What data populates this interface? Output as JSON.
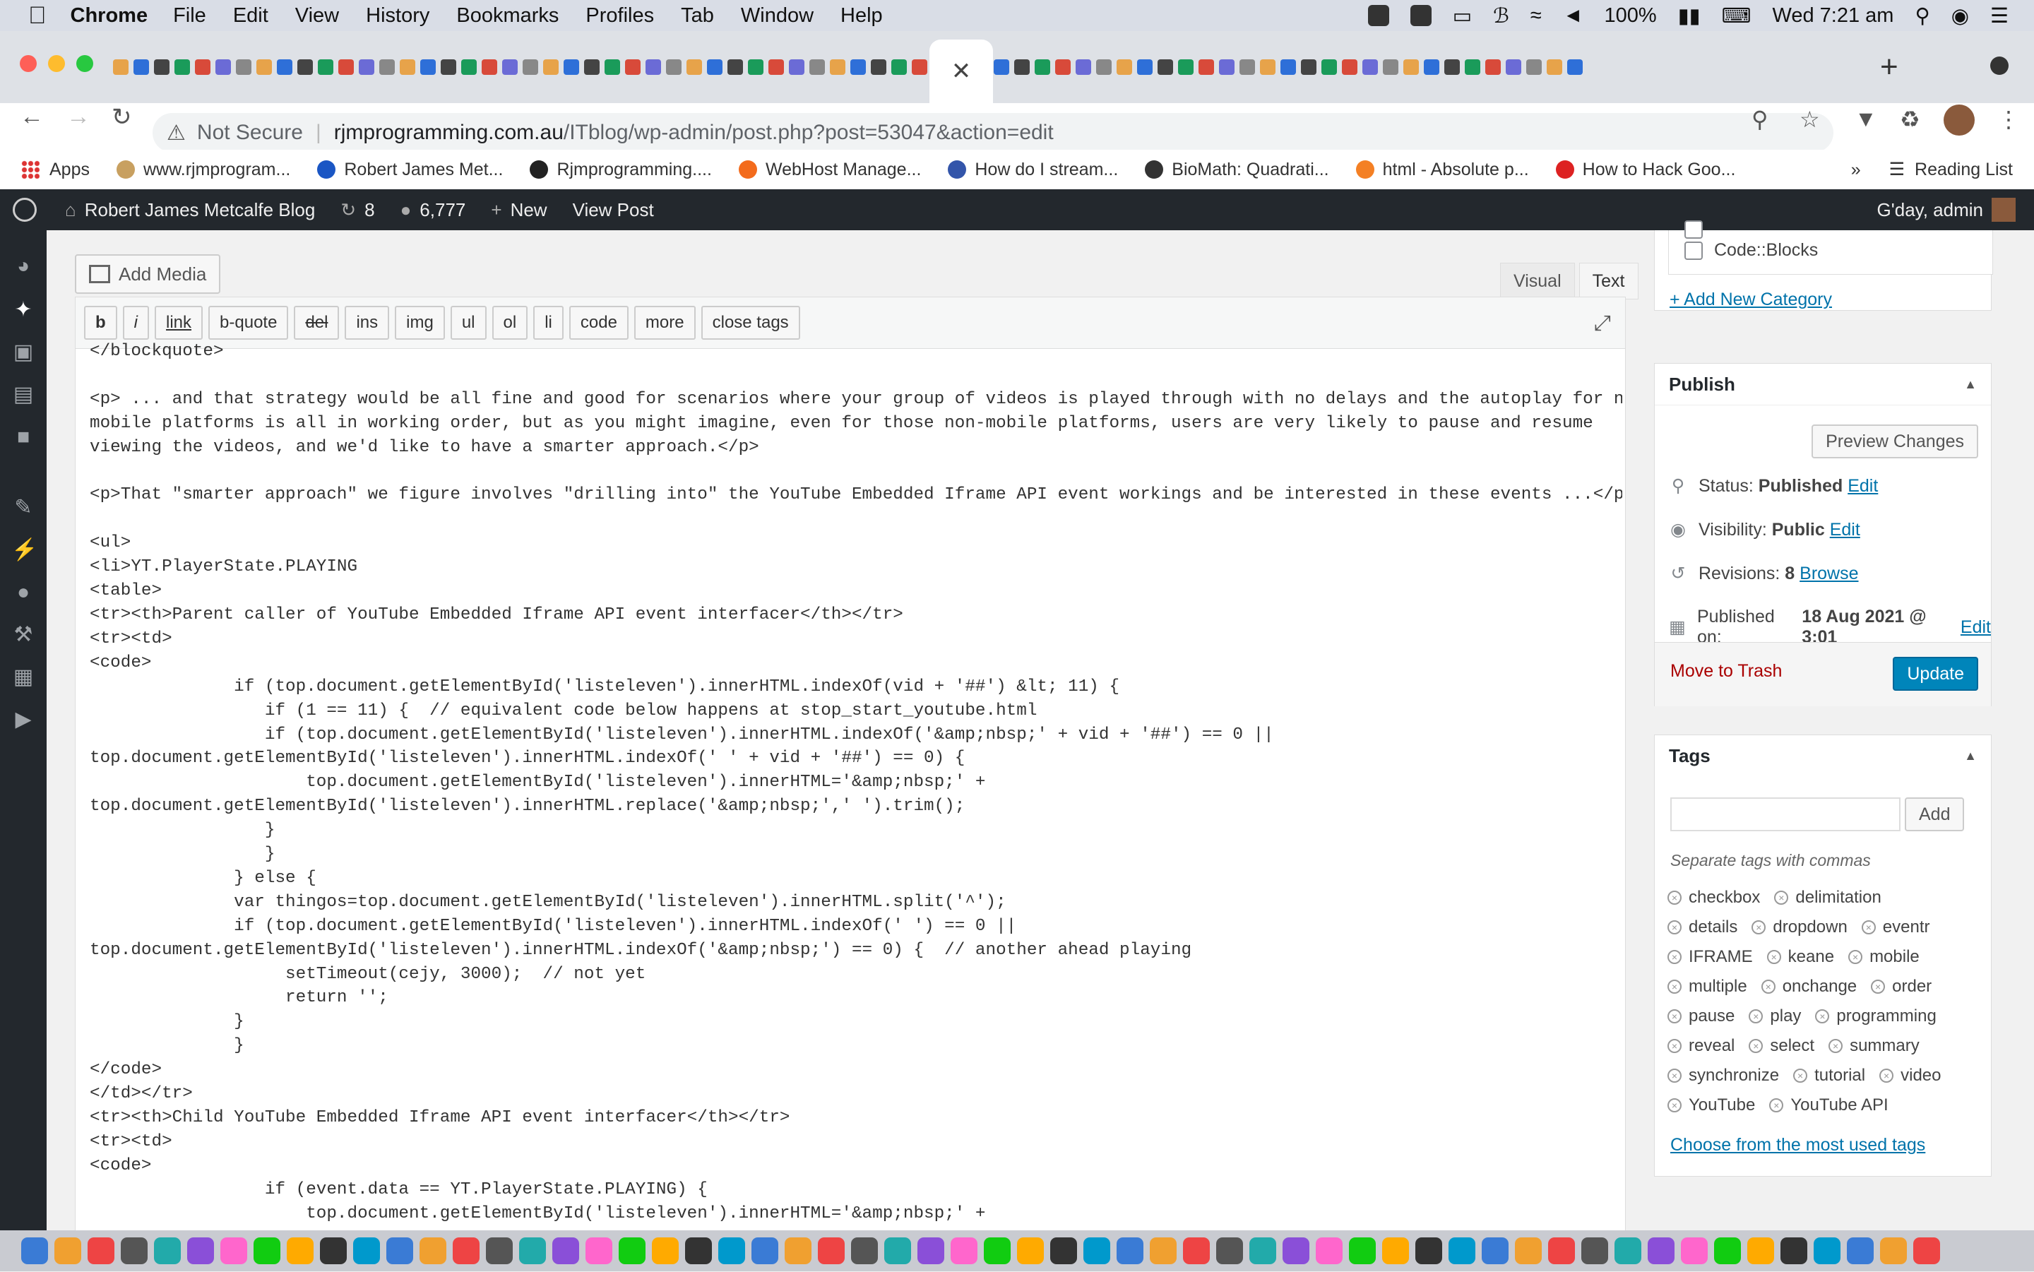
{
  "menubar": {
    "app": "Chrome",
    "items": [
      "File",
      "Edit",
      "View",
      "History",
      "Bookmarks",
      "Profiles",
      "Tab",
      "Window",
      "Help"
    ],
    "battery": "100%",
    "datetime": "Wed 7:21 am"
  },
  "browser": {
    "address": {
      "security": "Not Secure",
      "host": "rjmprogramming.com.au",
      "path": "/ITblog/wp-admin/post.php?post=53047&action=edit"
    },
    "bookmarks": [
      {
        "label": "Apps",
        "color": "#d44"
      },
      {
        "label": "www.rjmprogram...",
        "color": "#c8a060"
      },
      {
        "label": "Robert James Met...",
        "color": "#1a56c4"
      },
      {
        "label": "Rjmprogramming....",
        "color": "#222"
      },
      {
        "label": "WebHost Manage...",
        "color": "#f36b1c"
      },
      {
        "label": "How do I stream...",
        "color": "#3355aa"
      },
      {
        "label": "BioMath: Quadrati...",
        "color": "#333"
      },
      {
        "label": "html - Absolute p...",
        "color": "#f48024"
      },
      {
        "label": "How to Hack Goo...",
        "color": "#d22"
      }
    ],
    "reading_list": "Reading List",
    "overflow": "»"
  },
  "adminbar": {
    "site": "Robert James Metcalfe Blog",
    "updates": "8",
    "comments": "6,777",
    "new": "New",
    "view_post": "View Post",
    "howdy": "G'day, admin"
  },
  "editor": {
    "add_media": "Add Media",
    "visual_tab": "Visual",
    "text_tab": "Text",
    "quicktags": [
      "b",
      "i",
      "link",
      "b-quote",
      "del",
      "ins",
      "img",
      "ul",
      "ol",
      "li",
      "code",
      "more",
      "close tags"
    ],
    "code": "</blockquote>\n\n<p> ... and that strategy would be all fine and good for scenarios where your group of videos is played through with no delays and the autoplay for non-\nmobile platforms is all in working order, but as you might imagine, even for those non-mobile platforms, users are very likely to pause and resume\nviewing the videos, and we'd like to have a smarter approach.</p>\n\n<p>That \"smarter approach\" we figure involves \"drilling into\" the YouTube Embedded Iframe API event workings and be interested in these events ...</p>\n\n<ul>\n<li>YT.PlayerState.PLAYING\n<table>\n<tr><th>Parent caller of YouTube Embedded Iframe API event interfacer</th></tr>\n<tr><td>\n<code>\n              if (top.document.getElementById('listeleven').innerHTML.indexOf(vid + '##') &lt; 11) {\n                 if (1 == 11) {  // equivalent code below happens at stop_start_youtube.html\n                 if (top.document.getElementById('listeleven').innerHTML.indexOf('&amp;nbsp;' + vid + '##') == 0 ||\ntop.document.getElementById('listeleven').innerHTML.indexOf(' ' + vid + '##') == 0) {\n                     top.document.getElementById('listeleven').innerHTML='&amp;nbsp;' +\ntop.document.getElementById('listeleven').innerHTML.replace('&amp;nbsp;',' ').trim();\n                 }\n                 }\n              } else {\n              var thingos=top.document.getElementById('listeleven').innerHTML.split('^');\n              if (top.document.getElementById('listeleven').innerHTML.indexOf(' ') == 0 ||\ntop.document.getElementById('listeleven').innerHTML.indexOf('&amp;nbsp;') == 0) {  // another ahead playing\n                   setTimeout(cejy, 3000);  // not yet\n                   return '';\n              }\n              }\n</code>\n</td></tr>\n<tr><th>Child YouTube Embedded Iframe API event interfacer</th></tr>\n<tr><td>\n<code>\n                 if (event.data == YT.PlayerState.PLAYING) {\n                     top.document.getElementById('listeleven').innerHTML='&amp;nbsp;' +"
  },
  "categories": {
    "visible_item": "Code::Blocks",
    "add_new": "+ Add New Category"
  },
  "publish": {
    "title": "Publish",
    "preview": "Preview Changes",
    "status_label": "Status:",
    "status_value": "Published",
    "visibility_label": "Visibility:",
    "visibility_value": "Public",
    "revisions_label": "Revisions:",
    "revisions_value": "8",
    "browse": "Browse",
    "published_on_label": "Published on:",
    "published_on_value": "18 Aug 2021 @ 3:01",
    "edit": "Edit",
    "trash": "Move to Trash",
    "update": "Update"
  },
  "tags": {
    "title": "Tags",
    "add": "Add",
    "hint": "Separate tags with commas",
    "items": [
      "checkbox",
      "delimitation",
      "details",
      "dropdown",
      "eventr",
      "IFRAME",
      "keane",
      "mobile",
      "multiple",
      "onchange",
      "order",
      "pause",
      "play",
      "programming",
      "reveal",
      "select",
      "summary",
      "synchronize",
      "tutorial",
      "video",
      "YouTube",
      "YouTube API"
    ],
    "most_used": "Choose from the most used tags"
  },
  "colors": {
    "wp_dark": "#23282d",
    "wp_link": "#0073aa",
    "wp_primary": "#0085ba",
    "trash": "#a00"
  }
}
